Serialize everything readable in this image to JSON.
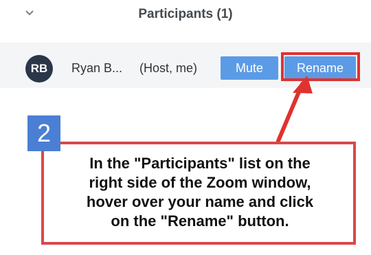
{
  "panel": {
    "title": "Participants",
    "count": "(1)"
  },
  "participant": {
    "initials": "RB",
    "name": "Ryan B...",
    "role": "(Host, me)"
  },
  "buttons": {
    "mute": "Mute",
    "rename": "Rename"
  },
  "annotation": {
    "step_number": "2",
    "lines": [
      "In the \"Participants\" list on the",
      "right side of the Zoom window,",
      "hover over your name and click",
      "on the \"Rename\" button."
    ]
  },
  "colors": {
    "accent_button": "#5b9be6",
    "highlight": "#e0322f",
    "step_badge": "#4a7fd4",
    "avatar": "#2b3748"
  }
}
